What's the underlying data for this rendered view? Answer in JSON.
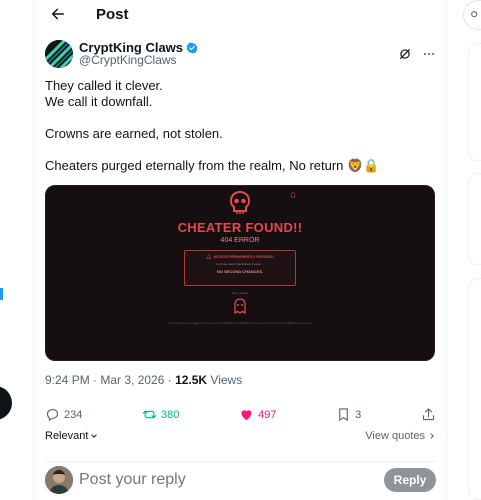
{
  "header": {
    "title": "Post"
  },
  "author": {
    "display_name": "CryptKing Claws",
    "handle": "@CryptKingClaws"
  },
  "post": {
    "line1": "They called it clever.",
    "line2": "We call it downfall.",
    "line3": "Crowns are earned, not stolen.",
    "line4": "Cheaters purged eternally from the realm, No return 🦁🔒"
  },
  "media": {
    "title": "CHEATER FOUND!!",
    "error": "404 ERROR",
    "alert_head": "ACCESS PERMANENTLY REVOKED",
    "alert_msg": "You have been blacklisted cheater ...",
    "alert_strong": "NO SECOND CHANCES.",
    "small_link": "Go to Home",
    "footnote": "This incident has been logged and reported to administrators. Unauthorized access attempts will result in additional consequences."
  },
  "meta": {
    "time": "9:24 PM · Mar 3, 2026 · ",
    "views_count": "12.5K",
    "views_label": " Views"
  },
  "actions": {
    "replies": "234",
    "reposts": "380",
    "likes": "497",
    "bookmarks": "3"
  },
  "sort": {
    "label": "Relevant"
  },
  "view_quotes": "View quotes",
  "reply": {
    "placeholder": "Post your reply",
    "button": "Reply"
  },
  "colors": {
    "accent": "#1d9bf0",
    "repost": "#00ba7c",
    "like": "#f91880",
    "danger": "#e5484d"
  }
}
